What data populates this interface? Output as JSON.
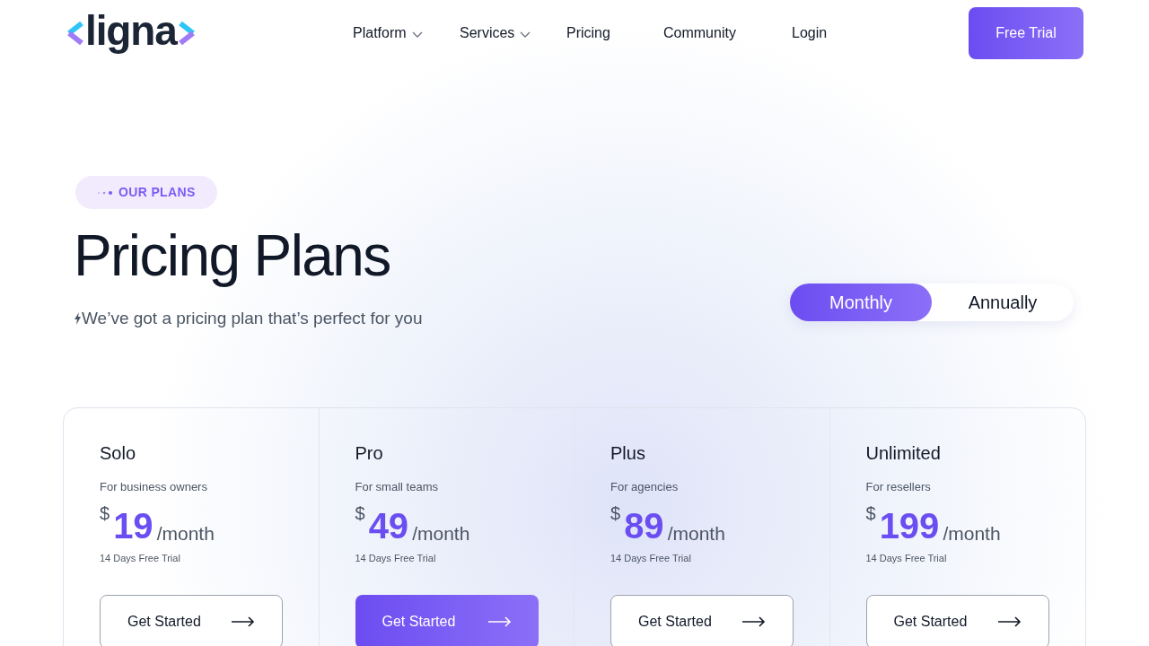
{
  "logo": {
    "text": "ligna"
  },
  "nav": [
    {
      "label": "Platform",
      "has_menu": true
    },
    {
      "label": "Services",
      "has_menu": true
    },
    {
      "label": "Pricing",
      "has_menu": false
    },
    {
      "label": "Community",
      "has_menu": false
    },
    {
      "label": "Login",
      "has_menu": false
    }
  ],
  "cta": "Free Trial",
  "badge": "OUR PLANS",
  "heading": "Pricing Plans",
  "subtitle": "We’ve got a pricing plan that’s perfect for you",
  "billing": [
    {
      "label": "Monthly",
      "selected": true
    },
    {
      "label": "Annually",
      "selected": false
    }
  ],
  "plans": [
    {
      "name": "Solo",
      "audience": "For business owners",
      "currency": "$",
      "price": "19",
      "period": "/month",
      "trial": "14 Days Free Trial",
      "button": "Get Started",
      "featured": false
    },
    {
      "name": "Pro",
      "audience": "For small teams",
      "currency": "$",
      "price": "49",
      "period": "/month",
      "trial": "14 Days Free Trial",
      "button": "Get Started",
      "featured": true
    },
    {
      "name": "Plus",
      "audience": "For agencies",
      "currency": "$",
      "price": "89",
      "period": "/month",
      "trial": "14 Days Free Trial",
      "button": "Get Started",
      "featured": false
    },
    {
      "name": "Unlimited",
      "audience": "For resellers",
      "currency": "$",
      "price": "199",
      "period": "/month",
      "trial": "14 Days Free Trial",
      "button": "Get Started",
      "featured": false
    }
  ]
}
